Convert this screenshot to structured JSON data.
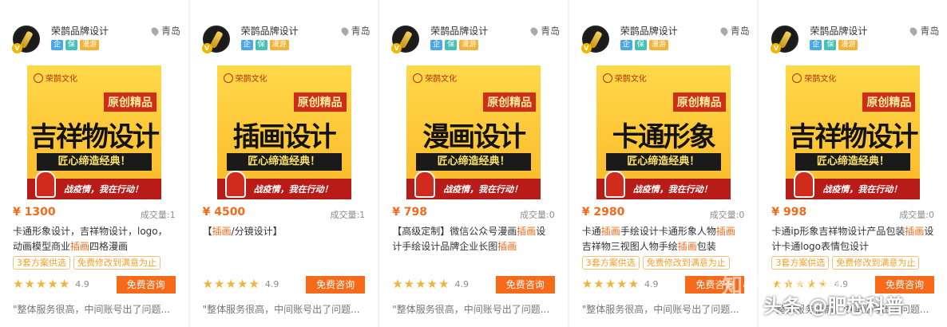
{
  "cards": [
    {
      "shop": "荣鹊品牌设计",
      "city": "青岛",
      "tags": [
        "企",
        "保",
        "漫游"
      ],
      "banner": {
        "brand": "荣鹊文化",
        "orig": "原创精品",
        "main": "吉祥物设计",
        "sub": "匠心缔造经典！",
        "slogan": "战疫情，我在行动！"
      },
      "price": "¥ 1300",
      "sales": "成交量:1",
      "title_parts": [
        "卡通形象设计，吉祥物设计，logo，动画模型商业",
        "插画",
        "四格漫画"
      ],
      "badges": [
        "3套方案供选",
        "免费修改到满意为止"
      ],
      "rating": "4.9",
      "button": "免费咨询",
      "review": "\"整体服务很高，中间账号出了问题..."
    },
    {
      "shop": "荣鹊品牌设计",
      "city": "青岛",
      "tags": [
        "企",
        "保",
        "漫游"
      ],
      "banner": {
        "brand": "荣鹊文化",
        "orig": "原创精品",
        "main": "插画设计",
        "sub": "匠心缔造经典！",
        "slogan": "战疫情，我在行动！"
      },
      "price": "¥ 4500",
      "sales": "成交量:1",
      "title_parts": [
        "【",
        "插画",
        "/分镜设计】"
      ],
      "badges": [],
      "rating": "4.9",
      "button": "免费咨询",
      "review": "\"整体服务很高，中间账号出了问题..."
    },
    {
      "shop": "荣鹊品牌设计",
      "city": "青岛",
      "tags": [
        "企",
        "保",
        "漫游"
      ],
      "banner": {
        "brand": "荣鹊文化",
        "orig": "原创精品",
        "main": "漫画设计",
        "sub": "匠心缔造经典！",
        "slogan": "战疫情，我在行动！"
      },
      "price": "¥ 798",
      "sales": "成交量:0",
      "title_parts": [
        "【高级定制】微信公众号漫画",
        "插画",
        "设计手绘设计品牌企业长图",
        "插画"
      ],
      "badges": [],
      "rating": "4.9",
      "button": "免费咨询",
      "review": "\"整体服务很高，中间账号出了问题..."
    },
    {
      "shop": "荣鹊品牌设计",
      "city": "青岛",
      "tags": [
        "企",
        "保",
        "漫游"
      ],
      "banner": {
        "brand": "荣鹊文化",
        "orig": "原创精品",
        "main": "卡通形象",
        "sub": "匠心缔造经典！",
        "slogan": "战疫情，我在行动！"
      },
      "price": "¥ 2980",
      "sales": "成交量:0",
      "title_parts": [
        "卡通",
        "插画",
        "手绘设计卡通形象人物",
        "插画",
        "吉祥物三视图人物手绘",
        "插画",
        "包装"
      ],
      "badges": [
        "3套方案供选",
        "免费修改到满意为止"
      ],
      "rating": "4.9",
      "button": "免费咨询",
      "review": "\"整体服务很高，中间账号出了问题..."
    },
    {
      "shop": "荣鹊品牌设计",
      "city": "青岛",
      "tags": [
        "企",
        "保",
        "漫游"
      ],
      "banner": {
        "brand": "荣鹊文化",
        "orig": "原创精品",
        "main": "吉祥物设计",
        "sub": "匠心缔造经典！",
        "slogan": "战疫情，我在行动！"
      },
      "price": "¥ 998",
      "sales": "成交量:0",
      "title_parts": [
        "卡通ip形象吉祥物设计产品包装",
        "插画",
        "设计卡通logo表情包设计"
      ],
      "badges": [
        "3套方案供选",
        "免费修改到满意为止"
      ],
      "rating": "4.9",
      "button": "免费咨询",
      "review": "\"整体服务很高，中间账号出了问题..."
    }
  ],
  "watermark": {
    "zhihu": "知乎 @老徐打折",
    "toutiao": "头条 @肥芯科普"
  },
  "colors": {
    "accent": "#f66a1a",
    "price": "#f26a1b",
    "star": "#f0b43a",
    "badge": "#f2a02c"
  }
}
